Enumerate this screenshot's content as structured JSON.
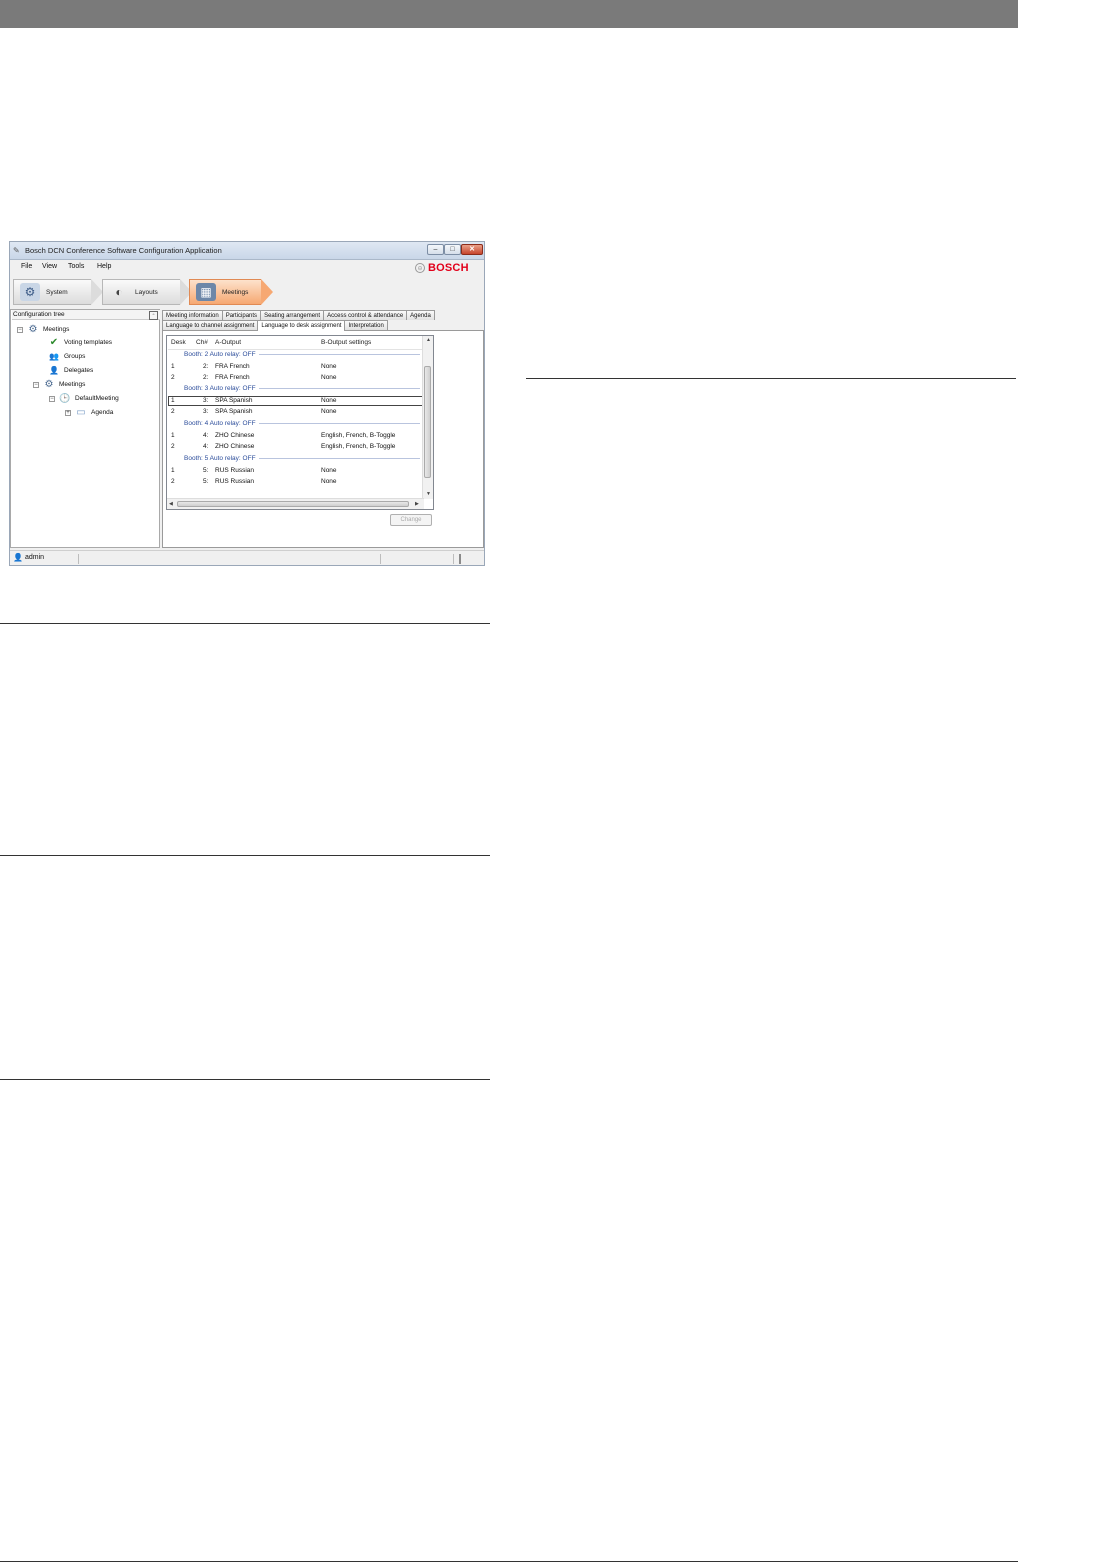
{
  "window": {
    "title": "Bosch DCN Conference Software Configuration Application",
    "brand": "BOSCH",
    "controls": {
      "minimize": "–",
      "maximize": "□",
      "close": "✕"
    }
  },
  "menu": [
    "File",
    "View",
    "Tools",
    "Help"
  ],
  "nav": [
    {
      "label": "System",
      "icon": "⚙"
    },
    {
      "label": "Layouts",
      "icon": "◐"
    },
    {
      "label": "Meetings",
      "icon": "▦"
    }
  ],
  "tree": {
    "header": "Configuration tree",
    "items": [
      {
        "label": "Meetings",
        "icon": "⚙"
      },
      {
        "label": "Voting templates",
        "icon": "✔"
      },
      {
        "label": "Groups",
        "icon": "👥"
      },
      {
        "label": "Delegates",
        "icon": "👤"
      },
      {
        "label": "Meetings",
        "icon": "⚙"
      },
      {
        "label": "DefaultMeeting",
        "icon": "🕒"
      },
      {
        "label": "Agenda",
        "icon": "▭"
      }
    ],
    "expand_collapsed": "+",
    "expand_open": "−"
  },
  "tabs": {
    "row1": [
      "Meeting information",
      "Participants",
      "Seating arrangement",
      "Access control & attendance",
      "Agenda"
    ],
    "row2": [
      "Language to channel assignment",
      "Language to desk assignment",
      "Interpretation"
    ],
    "active": "Language to desk assignment"
  },
  "table": {
    "columns": [
      "Desk",
      "Ch#",
      "A-Output",
      "B-Output settings"
    ],
    "groups": [
      {
        "header": "Booth: 2 Auto relay: OFF",
        "rows": [
          {
            "desk": "1",
            "ch": "2:",
            "a": "FRA French",
            "b": "None"
          },
          {
            "desk": "2",
            "ch": "2:",
            "a": "FRA French",
            "b": "None"
          }
        ]
      },
      {
        "header": "Booth: 3 Auto relay: OFF",
        "rows": [
          {
            "desk": "1",
            "ch": "3:",
            "a": "SPA Spanish",
            "b": "None"
          },
          {
            "desk": "2",
            "ch": "3:",
            "a": "SPA Spanish",
            "b": "None"
          }
        ]
      },
      {
        "header": "Booth: 4 Auto relay: OFF",
        "rows": [
          {
            "desk": "1",
            "ch": "4:",
            "a": "ZHO Chinese",
            "b": "English, French, B-Toggle"
          },
          {
            "desk": "2",
            "ch": "4:",
            "a": "ZHO Chinese",
            "b": "English, French, B-Toggle"
          }
        ]
      },
      {
        "header": "Booth: 5 Auto relay: OFF",
        "rows": [
          {
            "desk": "1",
            "ch": "5:",
            "a": "RUS Russian",
            "b": "None"
          },
          {
            "desk": "2",
            "ch": "5:",
            "a": "RUS Russian",
            "b": "None"
          }
        ]
      }
    ],
    "selected": "Booth: 3 Auto relay: OFF / desk 1"
  },
  "buttons": {
    "change": "Change"
  },
  "status": {
    "user": "admin"
  },
  "colors": {
    "topbar": "#7a7a7a",
    "brand": "#e2001a",
    "active_nav": "#f6a872"
  }
}
